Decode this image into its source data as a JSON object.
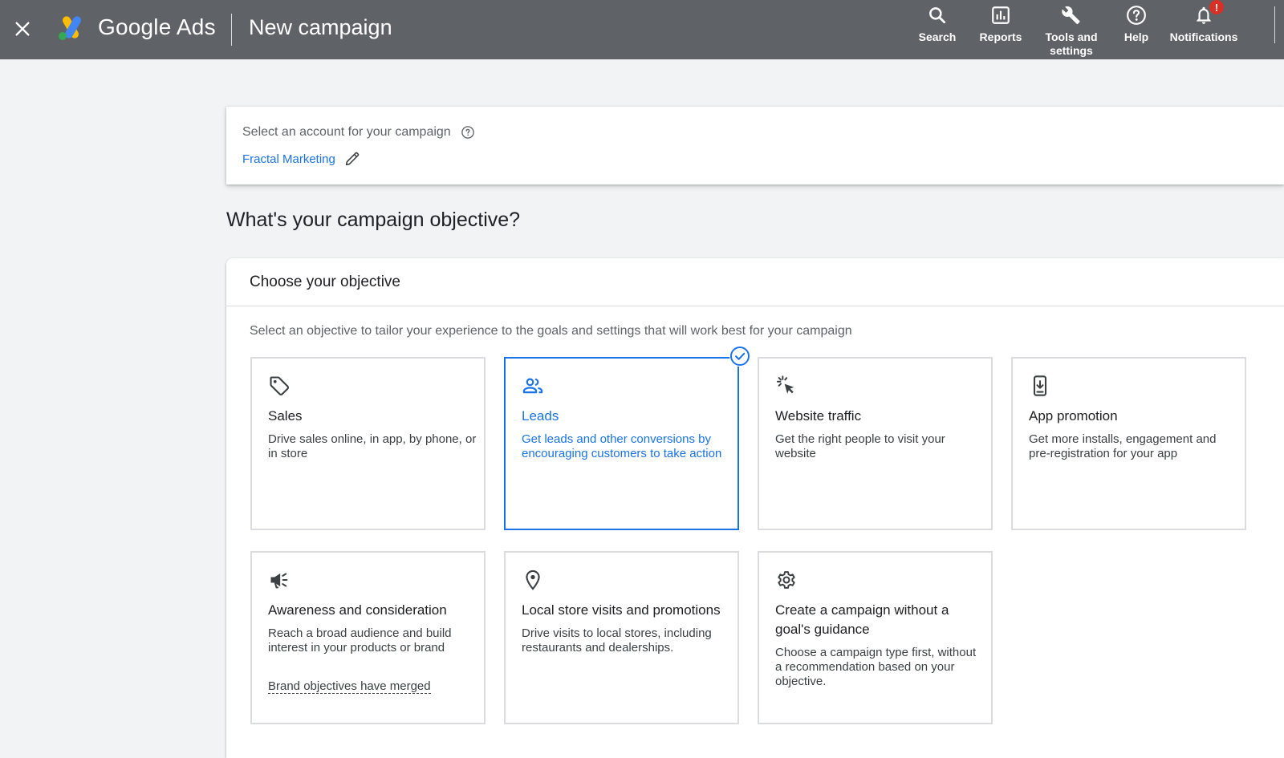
{
  "topbar": {
    "brand": "Google Ads",
    "page_title": "New campaign",
    "nav": {
      "search": "Search",
      "reports": "Reports",
      "tools": "Tools and settings",
      "help": "Help",
      "notifications": "Notifications",
      "notifications_badge": "!"
    }
  },
  "account": {
    "label": "Select an account for your campaign",
    "name": "Fractal Marketing"
  },
  "objective_heading": "What's your campaign objective?",
  "panel": {
    "title": "Choose your objective",
    "description": "Select an objective to tailor your experience to the goals and settings that will work best for your campaign",
    "cards": [
      {
        "icon": "tag-icon",
        "title": "Sales",
        "description": "Drive sales online, in app, by phone, or in store",
        "selected": false
      },
      {
        "icon": "people-icon",
        "title": "Leads",
        "description": "Get leads and other conversions by encouraging customers to take action",
        "selected": true
      },
      {
        "icon": "cursor-click-icon",
        "title": "Website traffic",
        "description": "Get the right people to visit your website",
        "selected": false
      },
      {
        "icon": "phone-download-icon",
        "title": "App promotion",
        "description": "Get more installs, engagement and pre-registration for your app",
        "selected": false
      },
      {
        "icon": "megaphone-icon",
        "title": "Awareness and consideration",
        "description": "Reach a broad audience and build interest in your products or brand",
        "note": "Brand objectives have merged",
        "selected": false
      },
      {
        "icon": "location-pin-icon",
        "title": "Local store visits and promotions",
        "description": "Drive visits to local stores, including restaurants and dealerships.",
        "selected": false
      },
      {
        "icon": "gear-icon",
        "title": "Create a campaign without a goal's guidance",
        "description": "Choose a campaign type first, without a recommendation based on your objective.",
        "selected": false
      }
    ]
  },
  "colors": {
    "topbar_bg": "#5f6368",
    "accent": "#1a73e8",
    "badge": "#d93025",
    "page_bg": "#f1f3f4"
  }
}
